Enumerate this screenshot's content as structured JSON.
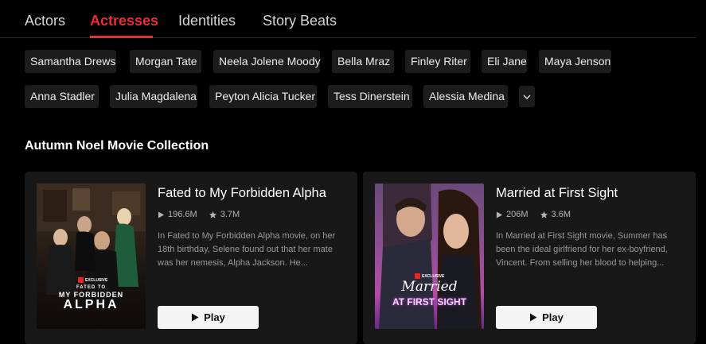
{
  "tabs": [
    {
      "label": "Actors"
    },
    {
      "label": "Actresses"
    },
    {
      "label": "Identities"
    },
    {
      "label": "Story Beats"
    }
  ],
  "chips": [
    "Samantha Drews",
    "Morgan Tate",
    "Neela Jolene Moody",
    "Bella Mraz",
    "Finley Riter",
    "Eli Jane",
    "Maya Jenson",
    "Anna Stadler",
    "Julia Magdalena",
    "Peyton Alicia Tucker",
    "Tess Dinerstein",
    "Alessia Medina"
  ],
  "section_title": "Autumn Noel Movie Collection",
  "movies": [
    {
      "title": "Fated to My Forbidden Alpha",
      "views": "196.6M",
      "rating": "3.7M",
      "description": "In Fated to My Forbidden Alpha movie, on her 18th birthday, Selene found out that her mate was her nemesis, Alpha Jackson. He...",
      "play_label": "Play",
      "poster_badge": "EXCLUSIVE",
      "poster_line1": "FATED TO",
      "poster_line2": "MY FORBIDDEN",
      "poster_line3": "ALPHA"
    },
    {
      "title": "Married at First Sight",
      "views": "206M",
      "rating": "3.6M",
      "description": "In Married at First Sight movie, Summer has been the ideal girlfriend for her ex-boyfriend, Vincent. From selling her blood to helping...",
      "play_label": "Play",
      "poster_badge": "EXCLUSIVE",
      "poster_line1": "Married",
      "poster_line2": "AT FIRST SIGHT"
    }
  ],
  "colors": {
    "accent": "#ef2b35",
    "card_bg": "#181818",
    "chip_bg": "#1c1c1c"
  }
}
